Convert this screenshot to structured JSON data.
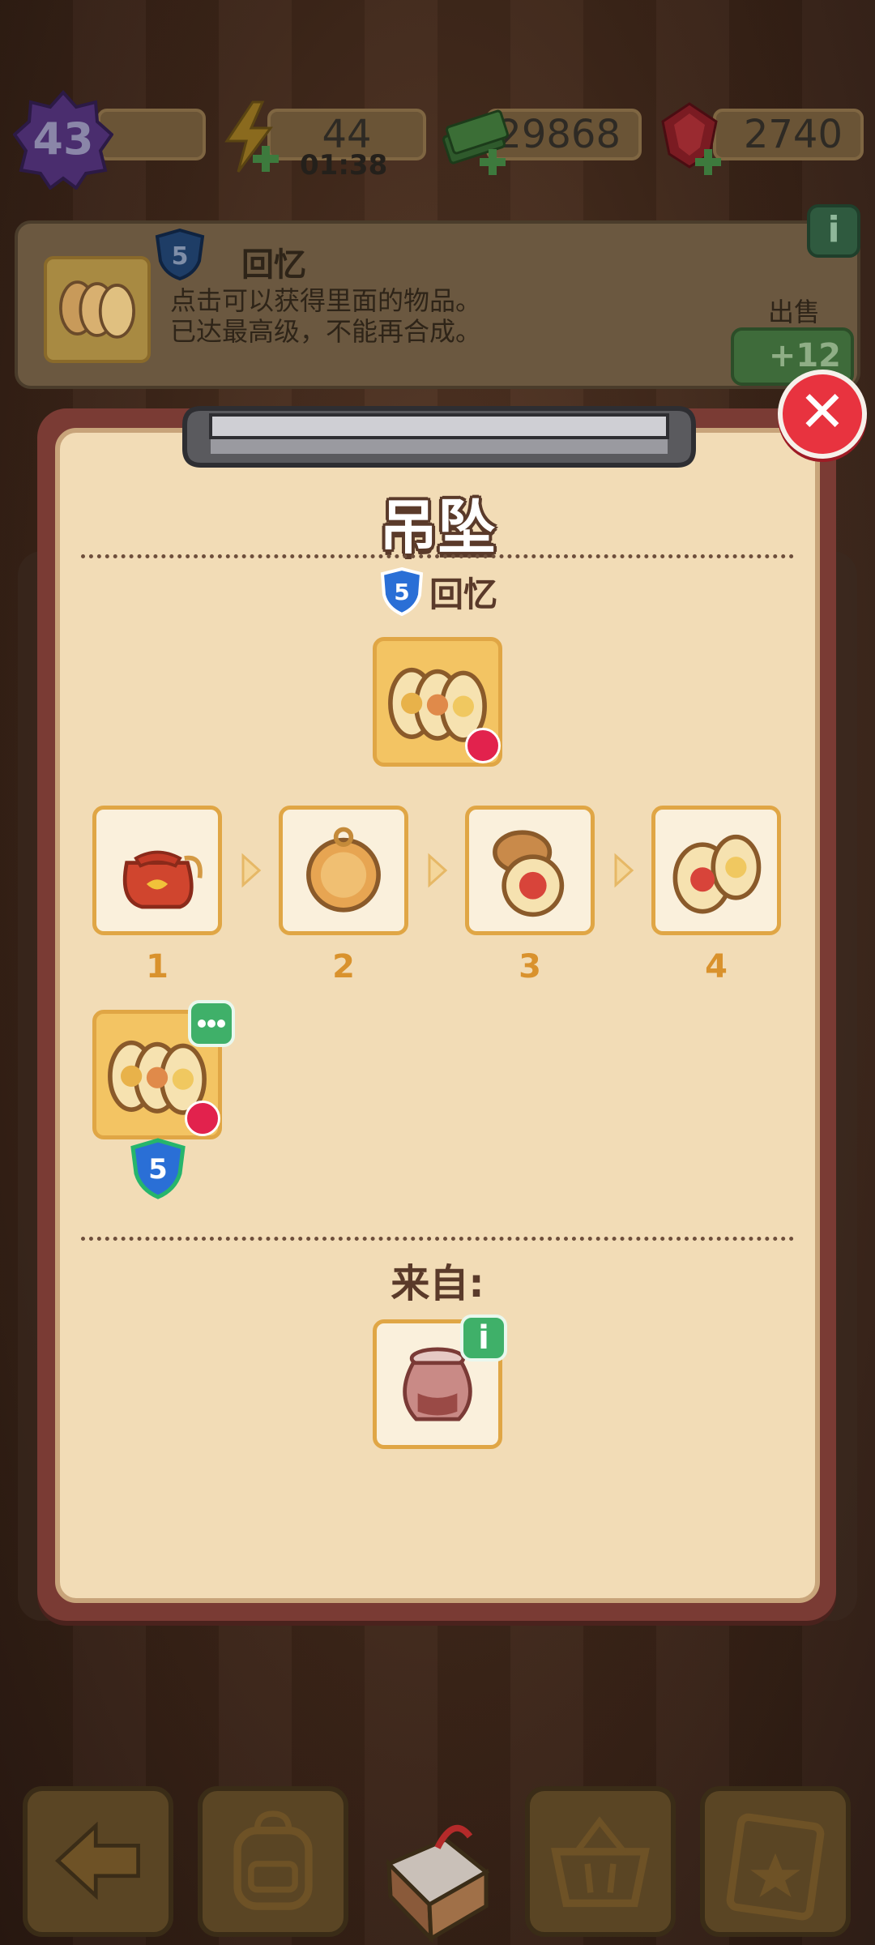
{
  "hud": {
    "level": "43",
    "energy": "44",
    "energy_timer": "01:38",
    "cash": "29868",
    "gems": "2740"
  },
  "info_panel": {
    "item_level": "5",
    "item_name": "回忆",
    "description_line1": "点击可以获得里面的物品。",
    "description_line2": "已达最高级，不能再合成。",
    "sell_label": "出售",
    "sell_value": "+12",
    "info_icon": "i"
  },
  "dialog": {
    "title": "吊坠",
    "series_level": "5",
    "series_name": "回忆",
    "steps": [
      {
        "label": "1",
        "icon": "red-pouch-icon"
      },
      {
        "label": "2",
        "icon": "closed-locket-icon"
      },
      {
        "label": "3",
        "icon": "open-locket-icon"
      },
      {
        "label": "4",
        "icon": "double-locket-icon"
      }
    ],
    "final_level": "5",
    "from_label": "来自:",
    "source_icon": "clay-pot-icon",
    "source_info": "i",
    "close_icon": "✕"
  },
  "colors": {
    "accent_gold": "#e0a645",
    "panel_bg": "#f2dcb6",
    "title_outline": "#5a3a2a",
    "close_red": "#e8333f",
    "badge_green": "#3fb069",
    "crown_red": "#e2224d",
    "shield_blue": "#2a6fd6"
  }
}
